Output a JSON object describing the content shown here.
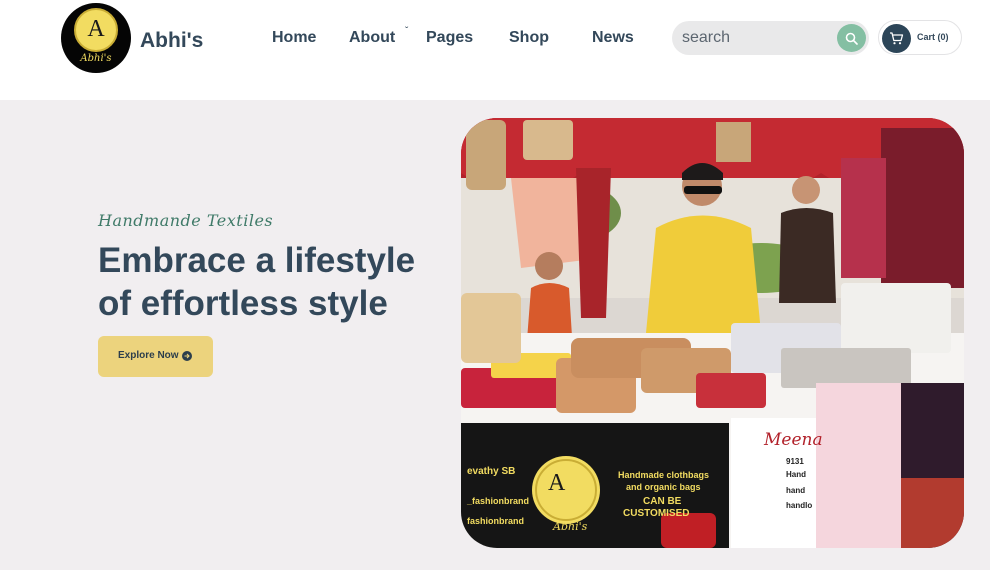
{
  "header": {
    "brand": "Abhi's",
    "logo": {
      "letter": "A",
      "script": "Abhi's"
    },
    "nav": [
      {
        "label": "Home"
      },
      {
        "label": "About"
      },
      {
        "label": "Pages"
      },
      {
        "label": "Shop"
      },
      {
        "label": "News"
      }
    ],
    "about_caret": "ˇ",
    "search": {
      "placeholder": "search",
      "icon": "search-icon"
    },
    "cart": {
      "label": "Cart (0)",
      "icon": "cart-icon"
    }
  },
  "hero": {
    "eyebrow": "Handmande Textiles",
    "headline_line1": "Embrace a lifestyle",
    "headline_line2": "of effortless style",
    "cta_label": "Explore Now",
    "cta_icon": "arrow-right-circle-icon",
    "photo": {
      "sign_name": "evathy SB",
      "sign_handle1": "_fashionbrand",
      "sign_handle2": "fashionbrand",
      "sign_tagline1": "Handmade clothbags",
      "sign_tagline2": "and organic bags",
      "sign_callout1": "CAN BE",
      "sign_callout2": "CUSTOMISED",
      "sign_logo_letter": "A",
      "sign_logo_script": "Abhi's",
      "board_name": "Meena",
      "board_phone": "9131",
      "board_lines": [
        "Hand",
        "hand",
        "handlo"
      ]
    }
  },
  "colors": {
    "primary_text": "#33485a",
    "accent_green": "#84bfa3",
    "cta_yellow": "#ecd37d",
    "hero_bg": "#f1eef0",
    "logo_gold": "#f2dc61"
  }
}
